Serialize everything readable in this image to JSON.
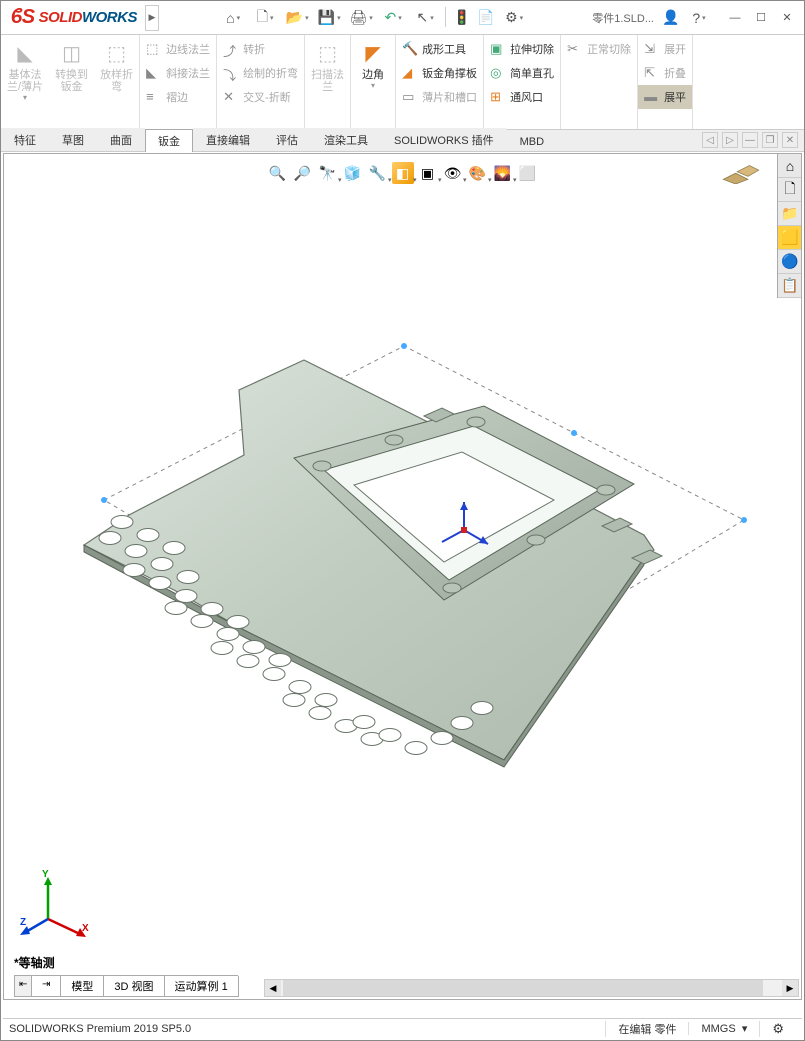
{
  "app": {
    "name_solid": "SOLID",
    "name_works": "WORKS",
    "doc": "零件1.SLD..."
  },
  "titlebar": {
    "home": "⌂",
    "new": "🗋",
    "open": "📂",
    "save": "💾",
    "print": "🖨",
    "undo": "↶",
    "select": "↖",
    "rebuild": "🟢",
    "options": "⚙",
    "user": "👤",
    "help": "?"
  },
  "ribbon": {
    "g1": [
      {
        "label": "基体法\n兰/薄片",
        "ico": "◣"
      },
      {
        "label": "转换到\n钣金",
        "ico": "◫"
      },
      {
        "label": "放样折\n弯",
        "ico": "⬚"
      }
    ],
    "g2": [
      {
        "label": "边线法兰",
        "ico": "⬚"
      },
      {
        "label": "斜接法兰",
        "ico": "◣"
      },
      {
        "label": "褶边",
        "ico": "≡"
      }
    ],
    "g3": [
      {
        "label": "转折",
        "ico": "⤴"
      },
      {
        "label": "绘制的折弯",
        "ico": "⤵"
      },
      {
        "label": "交叉-折断",
        "ico": "✕"
      }
    ],
    "g4": {
      "label": "扫描法\n兰",
      "ico": "⬚"
    },
    "g5": {
      "label": "边角",
      "ico": "◤"
    },
    "g6": [
      {
        "label": "成形工具",
        "ico": "🔨",
        "en": true
      },
      {
        "label": "钣金角撑板",
        "ico": "◢",
        "en": true
      },
      {
        "label": "薄片和槽口",
        "ico": "▭"
      }
    ],
    "g7": [
      {
        "label": "拉伸切除",
        "ico": "▣",
        "en": true
      },
      {
        "label": "简单直孔",
        "ico": "◎",
        "en": true
      },
      {
        "label": "通风口",
        "ico": "⊞",
        "en": true
      }
    ],
    "g8": [
      {
        "label": "正常切除",
        "ico": "✂"
      },
      {
        "label": "",
        "ico": ""
      },
      {
        "label": "",
        "ico": ""
      }
    ],
    "g9": [
      {
        "label": "展开",
        "ico": "⇲"
      },
      {
        "label": "折叠",
        "ico": "⇱"
      },
      {
        "label": "展平",
        "ico": "▬",
        "en": true,
        "hl": true
      }
    ]
  },
  "tabs": {
    "items": [
      "特征",
      "草图",
      "曲面",
      "钣金",
      "直接编辑",
      "评估",
      "渲染工具",
      "SOLIDWORKS 插件",
      "MBD"
    ],
    "active": 3
  },
  "viewbar": {
    "items": [
      "🔍",
      "🔎",
      "🔭",
      "🌐",
      "🔧",
      "🧊",
      "📐",
      "🎨",
      "🔆",
      "⬜",
      "◐",
      "📊",
      "👁",
      "🎯",
      "🟦",
      "📷"
    ]
  },
  "taskpanel": [
    "⌂",
    "🗋",
    "📁",
    "🟨",
    "🔵",
    "📋"
  ],
  "triad": {
    "x": "X",
    "y": "Y",
    "z": "Z"
  },
  "view_label": "*等轴测",
  "bottom_tabs": [
    "模型",
    "3D 视图",
    "运动算例 1"
  ],
  "status": {
    "left": "SOLIDWORKS Premium 2019 SP5.0",
    "mode": "在编辑 零件",
    "units": "MMGS"
  }
}
